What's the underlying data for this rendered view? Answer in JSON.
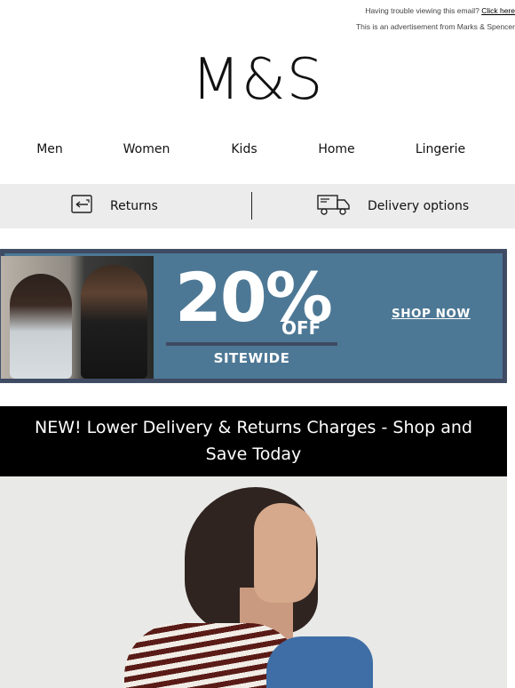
{
  "preheader": {
    "trouble_text": "Having trouble viewing this email?",
    "click_here": "Click here",
    "advert_text": "This is an advertisement from Marks & Spencer"
  },
  "logo": {
    "text": "M&S"
  },
  "nav": [
    {
      "label": "Men"
    },
    {
      "label": "Women"
    },
    {
      "label": "Kids"
    },
    {
      "label": "Home"
    },
    {
      "label": "Lingerie"
    }
  ],
  "services": {
    "returns": {
      "label": "Returns",
      "icon": "returns-icon"
    },
    "delivery": {
      "label": "Delivery options",
      "icon": "delivery-van-icon"
    }
  },
  "promo": {
    "percent": "20%",
    "off": "OFF",
    "sitewide": "SITEWIDE",
    "cta": "SHOP NOW",
    "colors": {
      "background": "#4d7895",
      "frame": "#3f4a63"
    }
  },
  "announcement": {
    "text": "NEW! Lower Delivery & Returns Charges - Shop and Save Today"
  },
  "colors": {
    "service_bar": "#ececec",
    "announcement_bg": "#000000"
  }
}
